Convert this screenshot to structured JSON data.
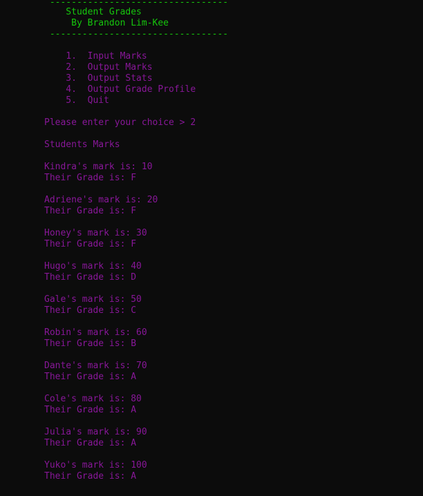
{
  "header": {
    "rule_top": " ---------------------------------",
    "title": "    Student Grades",
    "author": "     By Brandon Lim-Kee",
    "rule_bottom": " ---------------------------------"
  },
  "menu": {
    "items": [
      "    1.  Input Marks",
      "    2.  Output Marks",
      "    3.  Output Stats",
      "    4.  Output Grade Profile",
      "    5.  Quit"
    ]
  },
  "prompt": "Please enter your choice > 2",
  "section_title": "Students Marks",
  "students": [
    {
      "mark_line": "Kindra's mark is: 10",
      "grade_line": "Their Grade is: F"
    },
    {
      "mark_line": "Adriene's mark is: 20",
      "grade_line": "Their Grade is: F"
    },
    {
      "mark_line": "Honey's mark is: 30",
      "grade_line": "Their Grade is: F"
    },
    {
      "mark_line": "Hugo's mark is: 40",
      "grade_line": "Their Grade is: D"
    },
    {
      "mark_line": "Gale's mark is: 50",
      "grade_line": "Their Grade is: C"
    },
    {
      "mark_line": "Robin's mark is: 60",
      "grade_line": "Their Grade is: B"
    },
    {
      "mark_line": "Dante's mark is: 70",
      "grade_line": "Their Grade is: A"
    },
    {
      "mark_line": "Cole's mark is: 80",
      "grade_line": "Their Grade is: A"
    },
    {
      "mark_line": "Julia's mark is: 90",
      "grade_line": "Their Grade is: A"
    },
    {
      "mark_line": "Yuko's mark is: 100",
      "grade_line": "Their Grade is: A"
    }
  ],
  "colors": {
    "background": "#0c0c0c",
    "header_text": "#16c60c",
    "body_text": "#881798"
  }
}
